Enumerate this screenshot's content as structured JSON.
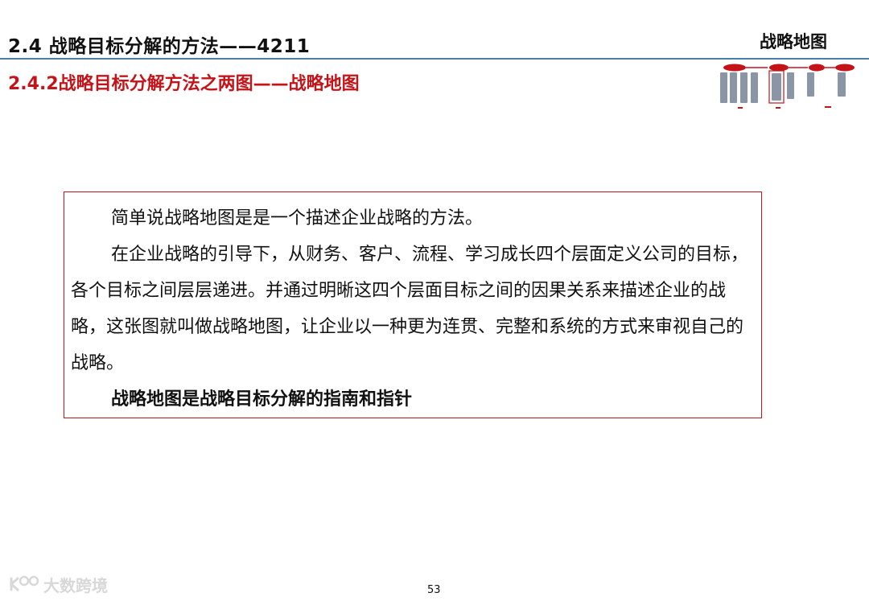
{
  "header": {
    "title": "2.4  战略目标分解的方法——4211",
    "right_label": "战略地图",
    "subtitle": "2.4.2战略目标分解方法之两图——战略地图"
  },
  "content": {
    "paragraphs": [
      "简单说战略地图是是一个描述企业战略的方法。",
      "在企业战略的引导下，从财务、客户、流程、学习成长四个层面定义公司的目标，各个目标之间层层递进。并通过明晰这四个层面目标之间的因果关系来描述企业的战略，这张图就叫做战略地图，让企业以一种更为连贯、完整和系统的方式来审视自己的战略。",
      "战略地图是战略目标分解的指南和指针"
    ]
  },
  "footer": {
    "page_number": "53",
    "watermark_text": "大数跨境"
  },
  "colors": {
    "accent_red": "#c4141a",
    "rule_blue": "#4a7ea8"
  }
}
